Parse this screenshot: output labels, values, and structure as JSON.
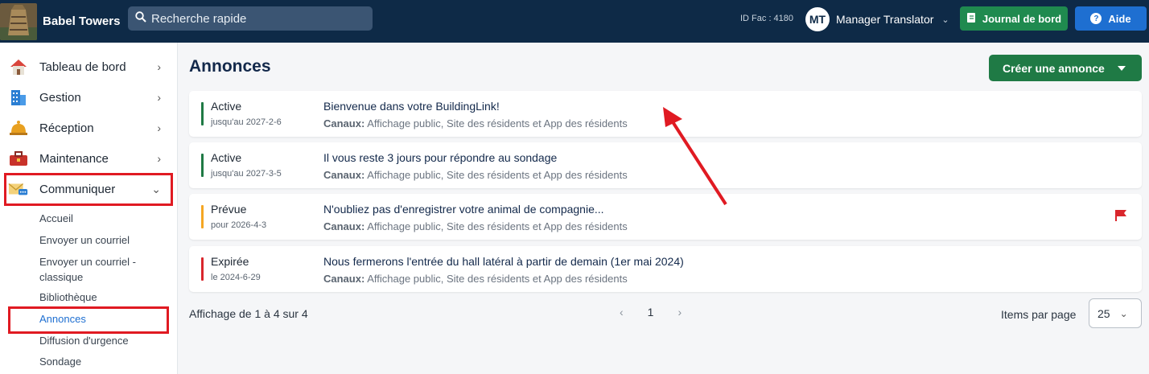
{
  "app": {
    "title": "Babel Towers"
  },
  "search": {
    "placeholder": "Recherche rapide"
  },
  "header": {
    "fac_id": "ID Fac : 4180",
    "user_initials": "MT",
    "user_name": "Manager Translator",
    "journal_label": "Journal de bord",
    "help_label": "Aide"
  },
  "sidebar": {
    "items": [
      {
        "label": "Tableau de bord",
        "icon": "house-icon"
      },
      {
        "label": "Gestion",
        "icon": "building-icon"
      },
      {
        "label": "Réception",
        "icon": "bell-icon"
      },
      {
        "label": "Maintenance",
        "icon": "toolbox-icon"
      },
      {
        "label": "Communiquer",
        "icon": "envelope-icon"
      }
    ],
    "subitems": [
      {
        "label": "Accueil"
      },
      {
        "label": "Envoyer un courriel"
      },
      {
        "label": "Envoyer un courriel - classique"
      },
      {
        "label": "Bibliothèque"
      },
      {
        "label": "Annonces",
        "active": true
      },
      {
        "label": "Diffusion d'urgence"
      },
      {
        "label": "Sondage"
      }
    ]
  },
  "main": {
    "title": "Annonces",
    "create_label": "Créer une annonce",
    "channels_label": "Canaux:",
    "announcements": [
      {
        "status": "Active",
        "date": "jusqu'au 2027-2-6",
        "title": "Bienvenue dans votre BuildingLink!",
        "channels": "Affichage public, Site des résidents et App des résidents",
        "color": "#1f7a45",
        "flag": false
      },
      {
        "status": "Active",
        "date": "jusqu'au 2027-3-5",
        "title": "Il vous reste 3 jours pour répondre au sondage",
        "channels": "Affichage public, Site des résidents et App des résidents",
        "color": "#1f7a45",
        "flag": false
      },
      {
        "status": "Prévue",
        "date": "pour 2026-4-3",
        "title": "N'oubliez pas d'enregistrer votre animal de compagnie...",
        "channels": "Affichage public, Site des résidents et App des résidents",
        "color": "#f5a623",
        "flag": true
      },
      {
        "status": "Expirée",
        "date": "le 2024-6-29",
        "title": "Nous fermerons l'entrée du hall latéral à partir de demain (1er mai 2024)",
        "channels": "Affichage public, Site des résidents et App des résidents",
        "color": "#d9262c",
        "flag": false
      }
    ],
    "showing": "Affichage de 1 à 4 sur 4",
    "page": "1",
    "items_per_page_label": "Items par page",
    "items_per_page": "25"
  },
  "colors": {
    "header_bg": "#0e2a47",
    "highlight": "#e01a22",
    "primary_green": "#1f7a45",
    "help_blue": "#1e6fd1"
  }
}
